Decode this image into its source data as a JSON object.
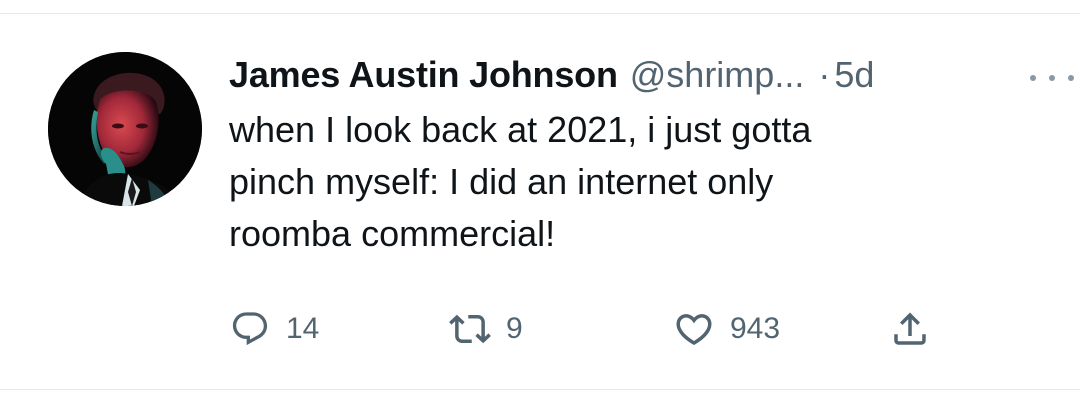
{
  "tweet": {
    "author": {
      "name": "James Austin Johnson",
      "handle": "@shrimp...",
      "avatar_icon": "profile-photo"
    },
    "separator": "·",
    "time": "5d",
    "lines": [
      "when I look back at 2021, i just gotta",
      "pinch myself: I did an internet only",
      "roomba commercial!"
    ],
    "metrics": {
      "replies": "14",
      "retweets": "9",
      "likes": "943"
    },
    "icons": {
      "more": "more-icon",
      "reply": "reply-icon",
      "retweet": "retweet-icon",
      "like": "heart-icon",
      "share": "share-icon"
    },
    "colors": {
      "text": "#0f1419",
      "secondary": "#536471",
      "icon": "#536471",
      "divider": "#e6e9ec"
    }
  }
}
